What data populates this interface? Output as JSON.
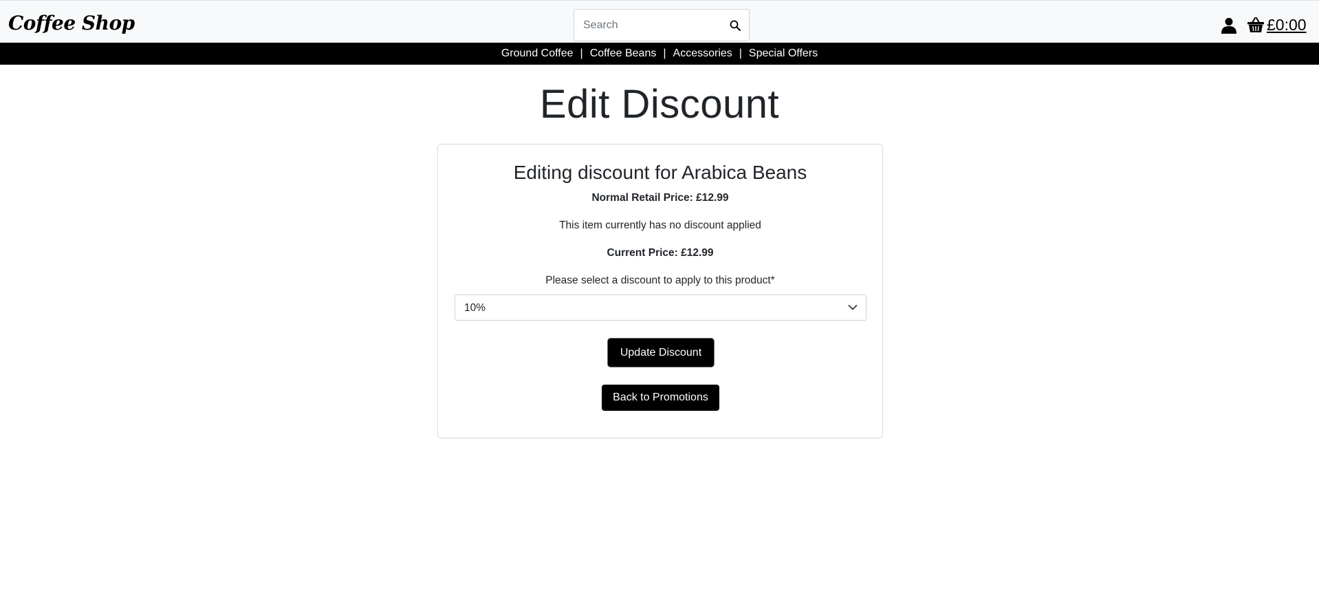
{
  "header": {
    "brand": "Coffee Shop",
    "search": {
      "placeholder": "Search",
      "value": ""
    },
    "search_icon": "search-icon",
    "account_icon": "user-icon",
    "basket_icon": "basket-icon",
    "basket_total": "£0:00"
  },
  "nav": {
    "items": [
      {
        "label": "Ground Coffee"
      },
      {
        "label": "Coffee Beans"
      },
      {
        "label": "Accessories"
      },
      {
        "label": "Special Offers"
      }
    ],
    "separator": "|"
  },
  "main": {
    "title": "Edit Discount",
    "card": {
      "heading": "Editing discount for Arabica Beans",
      "normal_price": "Normal Retail Price: £12.99",
      "discount_status": "This item currently has no discount applied",
      "current_price": "Current Price: £12.99",
      "select_label": "Please select a discount to apply to this product*",
      "select_value": "10%",
      "update_button": "Update Discount",
      "back_button": "Back to Promotions"
    }
  },
  "colors": {
    "navbar_bg": "#000000",
    "topbar_bg": "#f8f9fa",
    "button_bg": "#000000",
    "text": "#212529"
  }
}
